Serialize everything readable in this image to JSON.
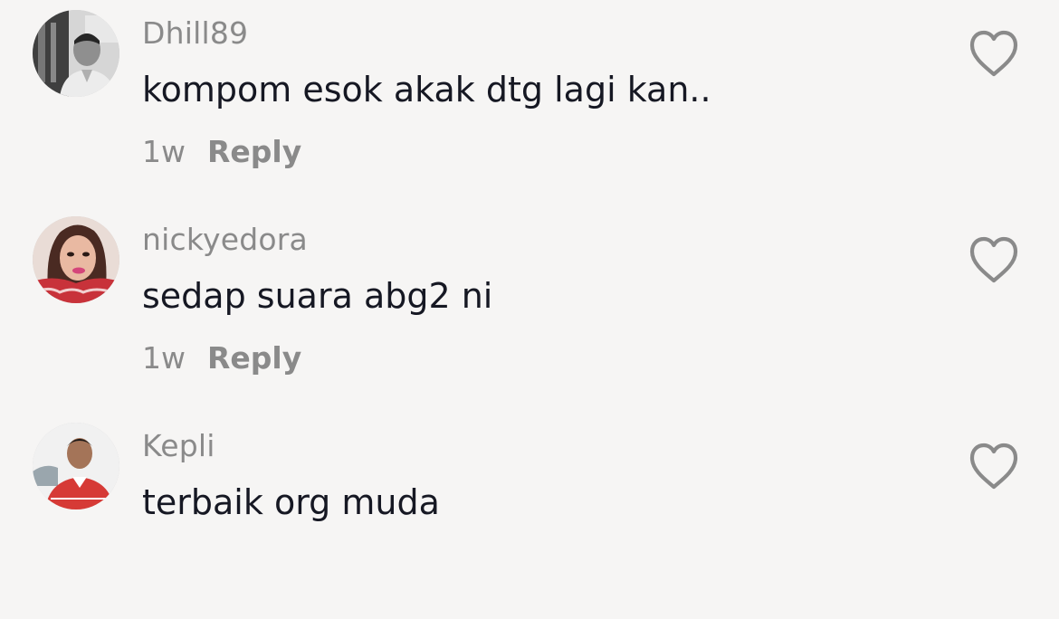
{
  "comments": [
    {
      "username": "Dhill89",
      "text": "kompom esok akak dtg lagi kan..",
      "time": "1w",
      "reply_label": "Reply",
      "avatar_icon": "user-avatar-photo",
      "like_icon": "heart-outline-icon"
    },
    {
      "username": "nickyedora",
      "text": "sedap suara abg2 ni",
      "time": "1w",
      "reply_label": "Reply",
      "avatar_icon": "user-avatar-photo",
      "like_icon": "heart-outline-icon"
    },
    {
      "username": "Kepli",
      "text": "terbaik org muda",
      "avatar_icon": "user-avatar-photo",
      "like_icon": "heart-outline-icon"
    }
  ],
  "colors": {
    "background": "#f6f5f4",
    "username": "#8a8a8a",
    "text": "#161823",
    "heart": "#8a8a8a"
  }
}
